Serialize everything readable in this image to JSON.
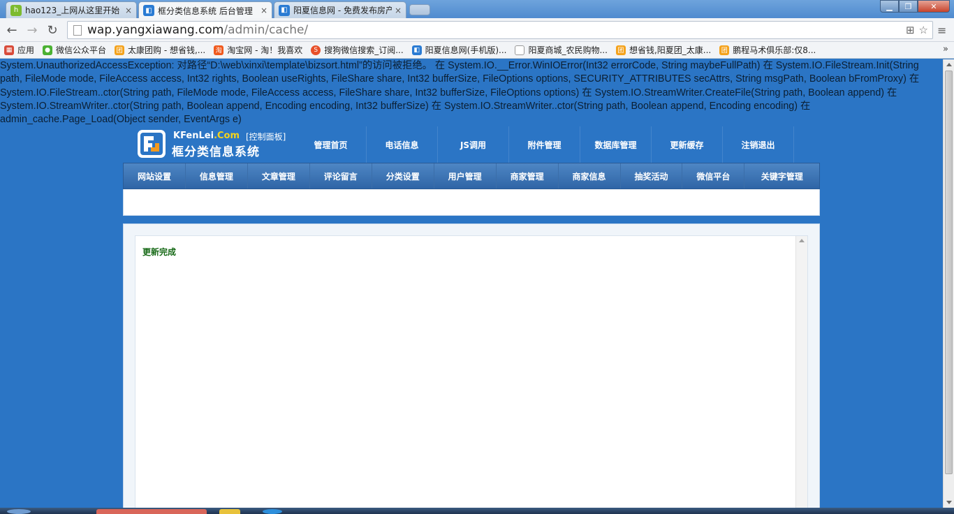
{
  "browser": {
    "tabs": [
      {
        "title": "hao123_上网从这里开始",
        "close": "×",
        "active": false
      },
      {
        "title": "框分类信息系统 后台管理",
        "close": "×",
        "active": true
      },
      {
        "title": "阳夏信息网 - 免费发布房产",
        "close": "×",
        "active": false
      }
    ],
    "window_controls": {
      "minimize": "▁",
      "maximize": "❐",
      "close": "✕"
    },
    "nav": {
      "back": "←",
      "forward": "→",
      "reload": "↻"
    },
    "url": {
      "host": "wap.yangxiawang.com",
      "path": "/admin/cache/"
    },
    "omnibox_icons": [
      "⊞",
      "☆"
    ],
    "menu": "≡",
    "bookmarks": [
      {
        "label": "应用",
        "icon_color": "#d84b3a"
      },
      {
        "label": "微信公众平台",
        "icon_color": "#4bb133"
      },
      {
        "label": "太康团购 - 想省钱,...",
        "icon_color": "#f4a21c"
      },
      {
        "label": "淘宝网 - 淘！我喜欢",
        "icon_color": "#f05a1e"
      },
      {
        "label": "搜狗微信搜索_订阅...",
        "icon_color": "#e8502a"
      },
      {
        "label": "阳夏信息网(手机版)...",
        "icon_color": "#2a7bd3"
      },
      {
        "label": "阳夏商城_农民购物...",
        "icon_color": "#e7e7e7"
      },
      {
        "label": "想省钱,阳夏团_太康...",
        "icon_color": "#f4a21c"
      },
      {
        "label": "鹏程马术俱乐部:仅8...",
        "icon_color": "#f4a21c"
      }
    ],
    "bookmarks_more": "»"
  },
  "error": {
    "text": "System.UnauthorizedAccessException: 对路径“D:\\web\\xinxi\\template\\bizsort.html”的访问被拒绝。 在 System.IO.__Error.WinIOError(Int32 errorCode, String maybeFullPath) 在 System.IO.FileStream.Init(String path, FileMode mode, FileAccess access, Int32 rights, Boolean useRights, FileShare share, Int32 bufferSize, FileOptions options, SECURITY_ATTRIBUTES secAttrs, String msgPath, Boolean bFromProxy) 在 System.IO.FileStream..ctor(String path, FileMode mode, FileAccess access, FileShare share, Int32 bufferSize, FileOptions options) 在 System.IO.StreamWriter.CreateFile(String path, Boolean append) 在 System.IO.StreamWriter..ctor(String path, Boolean append, Encoding encoding, Int32 bufferSize) 在 System.IO.StreamWriter..ctor(String path, Boolean append, Encoding encoding) 在 admin_cache.Page_Load(Object sender, EventArgs e)"
  },
  "header": {
    "logo_en_prefix": "KFenLei",
    "logo_en_suffix": ".Com",
    "panel_label": "[控制面板]",
    "logo_cn": "框分类信息系统",
    "topnav": [
      "管理首页",
      "电话信息",
      "JS调用",
      "附件管理",
      "数据库管理",
      "更新缓存",
      "注销退出"
    ]
  },
  "menu": [
    "网站设置",
    "信息管理",
    "文章管理",
    "评论留言",
    "分类设置",
    "用户管理",
    "商家管理",
    "商家信息",
    "抽奖活动",
    "微信平台",
    "关键字管理"
  ],
  "content": {
    "message": "更新完成"
  },
  "colors": {
    "page_bg": "#2b75c5",
    "menu_bg": "#3a70b0",
    "message": "#166916",
    "logo_orange": "#f39a1e"
  }
}
